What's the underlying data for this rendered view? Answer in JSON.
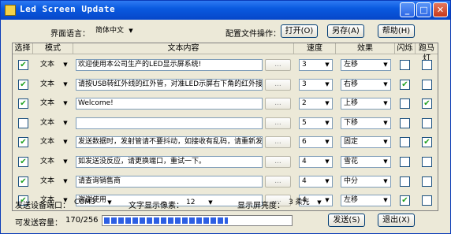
{
  "window": {
    "title": "Led Screen Update",
    "minimize_glyph": "_",
    "maximize_glyph": "□",
    "close_glyph": "✕"
  },
  "toolbar": {
    "language_label": "界面语言：",
    "language_value": "简体中文",
    "config_label": "配置文件操作：",
    "open_label": "打开(O)",
    "saveas_label": "另存(A)",
    "help_label": "帮助(H)"
  },
  "table": {
    "headers": [
      "选择",
      "模式",
      "文本内容",
      "速度",
      "效果",
      "闪烁",
      "跑马灯"
    ],
    "rows": [
      {
        "selected": true,
        "mode": "文本",
        "text": "欢迎使用本公司生产的LED显示屏系统!",
        "speed": "3",
        "effect": "左移",
        "blink": false,
        "marquee": false
      },
      {
        "selected": true,
        "mode": "文本",
        "text": "请按USB转红外线的红外管，对准LED示屏右下角的红外接收头",
        "speed": "3",
        "effect": "右移",
        "blink": true,
        "marquee": false
      },
      {
        "selected": true,
        "mode": "文本",
        "text": "Welcome!",
        "speed": "2",
        "effect": "上移",
        "blink": false,
        "marquee": true
      },
      {
        "selected": false,
        "mode": "文本",
        "text": "",
        "speed": "5",
        "effect": "下移",
        "blink": false,
        "marquee": false
      },
      {
        "selected": true,
        "mode": "文本",
        "text": "发送数据时，发射管请不要抖动，如接收有乱码，请重新发送",
        "speed": "6",
        "effect": "固定",
        "blink": false,
        "marquee": true
      },
      {
        "selected": true,
        "mode": "文本",
        "text": "如发送没反应，请更换端口，重试一下。",
        "speed": "4",
        "effect": "雪花",
        "blink": false,
        "marquee": false
      },
      {
        "selected": true,
        "mode": "文本",
        "text": "请查询销售商",
        "speed": "4",
        "effect": "中分",
        "blink": false,
        "marquee": false
      },
      {
        "selected": true,
        "mode": "文本",
        "text": "谢谢使用",
        "speed": "4",
        "effect": "左移",
        "blink": true,
        "marquee": false
      }
    ],
    "dots_label": "..."
  },
  "settings": {
    "port_label": "发送设备端口：",
    "port_value": "COM3",
    "pixel_label": "文字显示像素：",
    "pixel_value": "12",
    "brightness_label": "显示屏亮度：",
    "brightness_value": "3 柔光"
  },
  "status": {
    "capacity_label": "可发送容量：",
    "capacity_value": "170/256",
    "capacity_fraction": 0.664,
    "send_label": "发送(S)",
    "exit_label": "退出(X)"
  },
  "icons": {
    "check": "✔",
    "dropdown": "▼"
  },
  "colors": {
    "titlebar": "#0a5ae0",
    "progress": "#2d5fe3",
    "check": "#21a121"
  }
}
